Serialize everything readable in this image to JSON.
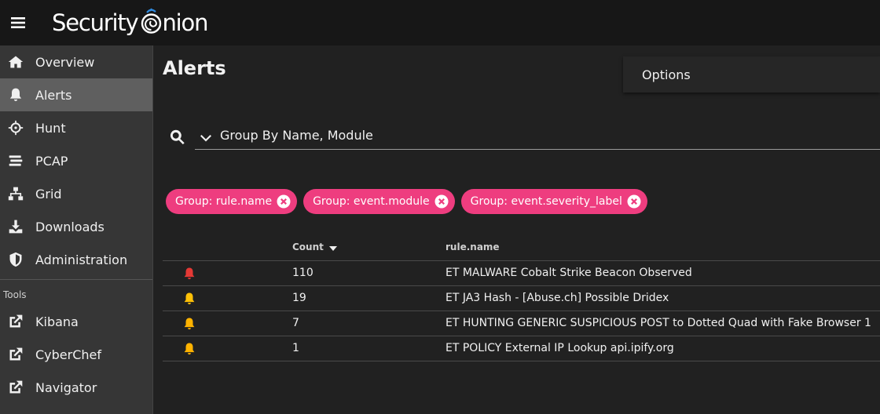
{
  "header": {
    "logo_text_left": "Security",
    "logo_text_right": "nion"
  },
  "sidebar": {
    "items": [
      {
        "label": "Overview",
        "icon": "home-icon"
      },
      {
        "label": "Alerts",
        "icon": "bell-icon",
        "active": true
      },
      {
        "label": "Hunt",
        "icon": "crosshairs-icon"
      },
      {
        "label": "PCAP",
        "icon": "stream-icon"
      },
      {
        "label": "Grid",
        "icon": "network-icon"
      },
      {
        "label": "Downloads",
        "icon": "download-icon"
      },
      {
        "label": "Administration",
        "icon": "shield-icon"
      }
    ],
    "tools_label": "Tools",
    "tools": [
      {
        "label": "Kibana",
        "icon": "external-link-icon"
      },
      {
        "label": "CyberChef",
        "icon": "external-link-icon"
      },
      {
        "label": "Navigator",
        "icon": "external-link-icon"
      }
    ]
  },
  "main": {
    "title": "Alerts",
    "options_label": "Options",
    "query": "Group By Name, Module",
    "chips": [
      {
        "label": "Group: rule.name"
      },
      {
        "label": "Group: event.module"
      },
      {
        "label": "Group: event.severity_label"
      }
    ],
    "table": {
      "columns": [
        "Count",
        "rule.name"
      ],
      "rows": [
        {
          "count": "110",
          "rule": "ET MALWARE Cobalt Strike Beacon Observed",
          "severity_color": "#e53935"
        },
        {
          "count": "19",
          "rule": "ET JA3 Hash - [Abuse.ch] Possible Dridex",
          "severity_color": "#ffc107"
        },
        {
          "count": "7",
          "rule": "ET HUNTING GENERIC SUSPICIOUS POST to Dotted Quad with Fake Browser 1",
          "severity_color": "#ffb300"
        },
        {
          "count": "1",
          "rule": "ET POLICY External IP Lookup api.ipify.org",
          "severity_color": "#ffb300"
        }
      ]
    }
  },
  "colors": {
    "accent_chip": "#ee3d7f",
    "severity_high": "#e53935",
    "severity_medium": "#ffc107"
  }
}
